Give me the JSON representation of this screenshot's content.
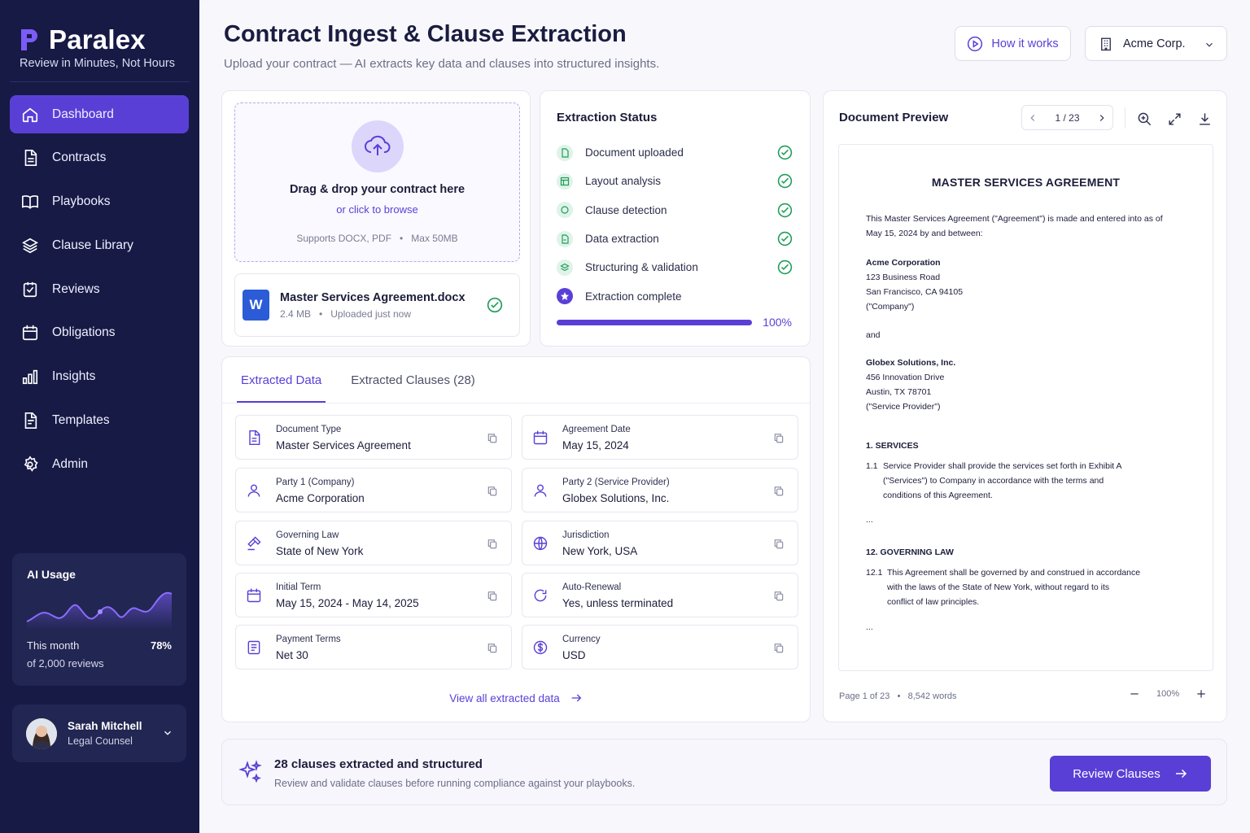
{
  "sidebar": {
    "brand": "Paralex",
    "tagline": "Review in Minutes, Not Hours",
    "items": [
      {
        "label": "Dashboard",
        "icon": "home-icon"
      },
      {
        "label": "Contracts",
        "icon": "file-icon"
      },
      {
        "label": "Playbooks",
        "icon": "book-icon"
      },
      {
        "label": "Clause Library",
        "icon": "layers-icon"
      },
      {
        "label": "Reviews",
        "icon": "check-square-icon"
      },
      {
        "label": "Obligations",
        "icon": "calendar-icon"
      },
      {
        "label": "Insights",
        "icon": "bar-chart-icon"
      },
      {
        "label": "Templates",
        "icon": "template-icon"
      },
      {
        "label": "Admin",
        "icon": "gear-icon"
      }
    ],
    "usage": {
      "title": "AI Usage",
      "label": "This month",
      "value": "78%",
      "sub": "of 2,000 reviews"
    },
    "user": {
      "name": "Sarah Mitchell",
      "role": "Legal Counsel"
    }
  },
  "header": {
    "title": "Contract Ingest & Clause Extraction",
    "subtitle": "Upload your contract — AI extracts key data and clauses into structured insights.",
    "how_label": "How it works",
    "org_label": "Acme Corp."
  },
  "upload": {
    "drop_title": "Drag & drop your contract here",
    "drop_link": "or click to browse",
    "supports": "Supports DOCX, PDF",
    "max": "Max 50MB",
    "file_name": "Master Services Agreement.docx",
    "file_size": "2.4 MB",
    "file_status": "Uploaded just now"
  },
  "status": {
    "title": "Extraction Status",
    "steps": [
      "Document uploaded",
      "Layout analysis",
      "Clause detection",
      "Data extraction",
      "Structuring & validation",
      "Extraction complete"
    ],
    "progress": 1.0,
    "progress_label": "100%"
  },
  "tabs": {
    "data": "Extracted Data",
    "clauses": "Extracted Clauses (28)"
  },
  "fields": [
    {
      "label": "Document Type",
      "value": "Master Services Agreement",
      "icon": "document-icon"
    },
    {
      "label": "Agreement Date",
      "value": "May 15, 2024",
      "icon": "calendar-icon"
    },
    {
      "label": "Party 1 (Company)",
      "value": "Acme Corporation",
      "icon": "user-icon"
    },
    {
      "label": "Party 2 (Service Provider)",
      "value": "Globex Solutions, Inc.",
      "icon": "user-icon"
    },
    {
      "label": "Governing Law",
      "value": "State of New York",
      "icon": "gavel-icon"
    },
    {
      "label": "Jurisdiction",
      "value": "New York, USA",
      "icon": "globe-icon"
    },
    {
      "label": "Initial Term",
      "value": "May 15, 2024 - May 14, 2025",
      "icon": "calendar-icon"
    },
    {
      "label": "Auto-Renewal",
      "value": "Yes, unless terminated",
      "icon": "refresh-icon"
    },
    {
      "label": "Payment Terms",
      "value": "Net 30",
      "icon": "receipt-icon"
    },
    {
      "label": "Currency",
      "value": "USD",
      "icon": "dollar-icon"
    }
  ],
  "view_all": "View all extracted data",
  "preview": {
    "title": "Document Preview",
    "page": "1 / 23",
    "doc_title": "MASTER SERVICES AGREEMENT",
    "intro1": "This Master Services Agreement (\"Agreement\") is made and entered into as of",
    "intro2": "May 15, 2024 by and between:",
    "party1_name": "Acme Corporation",
    "party1_addr1": "123 Business Road",
    "party1_addr2": "San Francisco, CA 94105",
    "party1_alias": "(\"Company\")",
    "and": "and",
    "party2_name": "Globex Solutions, Inc.",
    "party2_addr1": "456 Innovation Drive",
    "party2_addr2": "Austin, TX 78701",
    "party2_alias": "(\"Service Provider\")",
    "s1_head": "1.  SERVICES",
    "s1_num": "1.1",
    "s1_l1": "Service Provider shall provide the services set forth in Exhibit A",
    "s1_l2": "(\"Services\") to Company in accordance with the terms and",
    "s1_l3": "conditions of this Agreement.",
    "ellipsis": "...",
    "s12_head": "12.   GOVERNING LAW",
    "s12_num": "12.1",
    "s12_l1": "This Agreement shall be governed by and construed in accordance",
    "s12_l2": "with the laws of the State of New York, without regard to its",
    "s12_l3": "conflict of law principles.",
    "footer_page": "Page 1 of 23",
    "footer_words": "8,542 words",
    "zoom": "100%"
  },
  "bottom": {
    "title": "28 clauses extracted and structured",
    "sub": "Review and validate clauses before running compliance against your playbooks.",
    "button": "Review Clauses"
  },
  "colors": {
    "accent": "#5a3fd6",
    "sidebar": "#171a45",
    "success": "#1f9d5a"
  }
}
